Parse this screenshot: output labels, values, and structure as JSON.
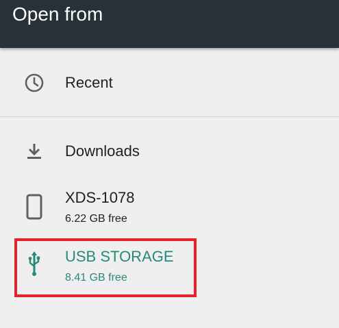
{
  "header": {
    "title": "Open from"
  },
  "items": [
    {
      "label": "Recent",
      "icon": "clock-icon"
    },
    {
      "label": "Downloads",
      "icon": "download-icon"
    },
    {
      "label": "XDS-1078",
      "sublabel": "6.22 GB free",
      "icon": "phone-icon"
    },
    {
      "label": "USB STORAGE",
      "sublabel": "8.41 GB free",
      "icon": "usb-icon",
      "selected": true,
      "color": "#26897a"
    }
  ],
  "colors": {
    "header_bg": "#263238",
    "background": "#efefef",
    "accent": "#26897a",
    "highlight_border": "#e8212a"
  }
}
